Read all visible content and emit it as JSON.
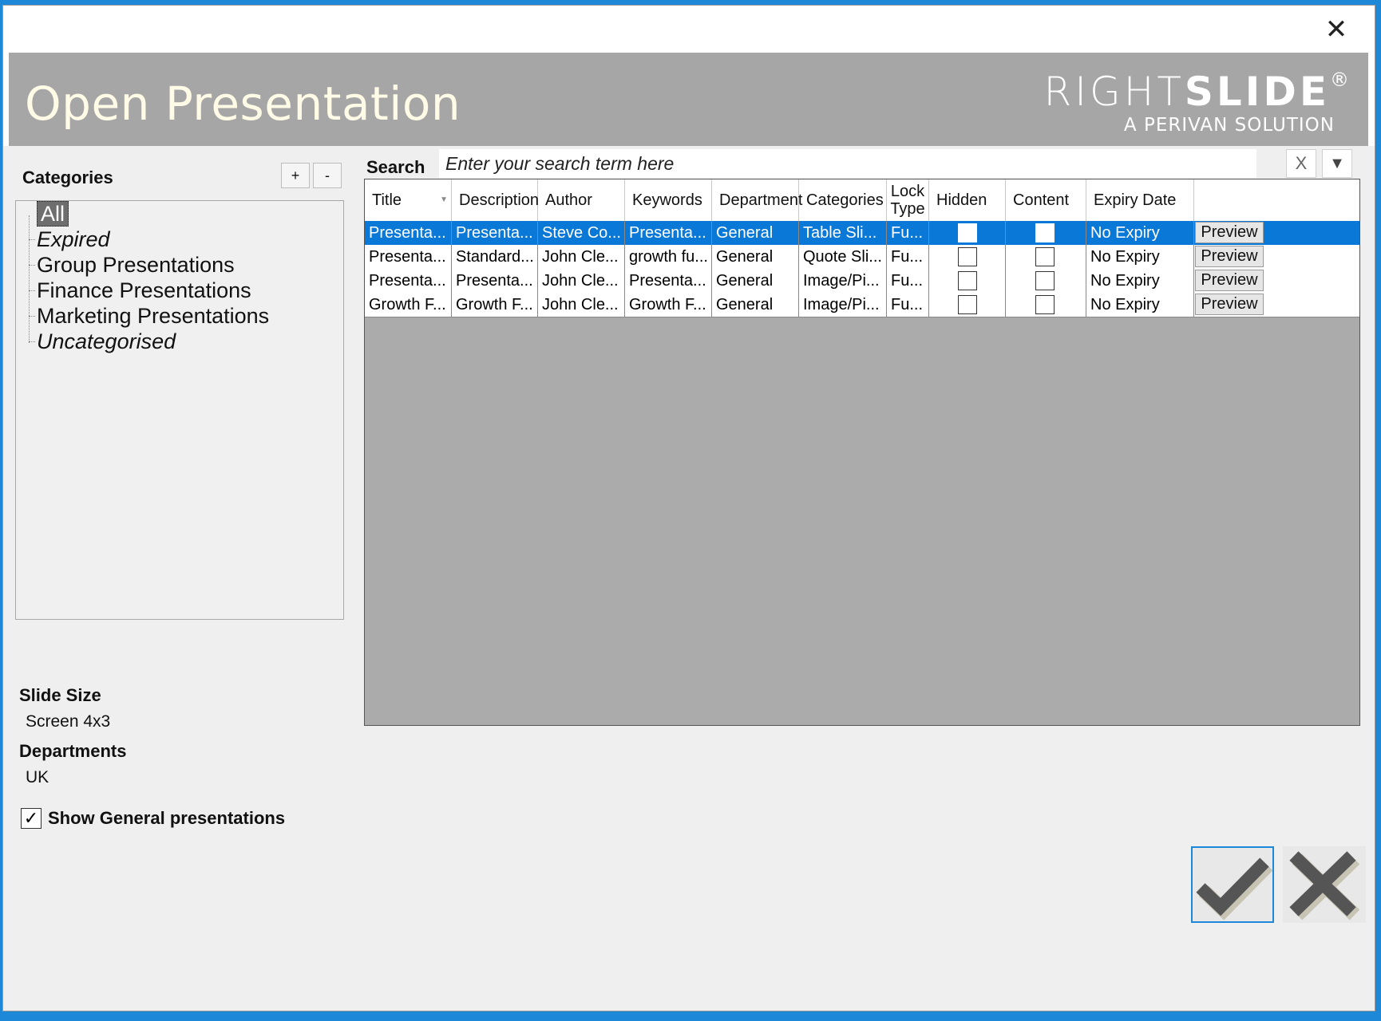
{
  "window": {
    "close_label": "✕"
  },
  "banner": {
    "title": "Open Presentation",
    "logo_right": "RIGHT",
    "logo_slide": "SLIDE",
    "logo_reg": "®",
    "logo_sub": "A PERIVAN SOLUTION"
  },
  "categories": {
    "label": "Categories",
    "add_label": "+",
    "remove_label": "-",
    "items": [
      {
        "label": "All",
        "selected": true,
        "italic": false
      },
      {
        "label": "Expired",
        "selected": false,
        "italic": true
      },
      {
        "label": "Group Presentations",
        "selected": false,
        "italic": false
      },
      {
        "label": "Finance Presentations",
        "selected": false,
        "italic": false
      },
      {
        "label": "Marketing Presentations",
        "selected": false,
        "italic": false
      },
      {
        "label": "Uncategorised",
        "selected": false,
        "italic": true
      }
    ]
  },
  "slide_size": {
    "label": "Slide Size",
    "value": "Screen 4x3"
  },
  "departments": {
    "label": "Departments",
    "value": "UK"
  },
  "show_general": {
    "label": "Show General presentations",
    "checked": true
  },
  "search": {
    "label": "Search",
    "placeholder": "Enter your search term here",
    "clear_label": "X",
    "dropdown_label": "▼"
  },
  "grid": {
    "columns": [
      "Title",
      "Description",
      "Author",
      "Keywords",
      "Department",
      "Categories",
      "Lock Type",
      "Hidden",
      "Content",
      "Expiry Date"
    ],
    "lock_type_line1": "Lock",
    "lock_type_line2": "Type",
    "preview_label": "Preview",
    "rows": [
      {
        "title": "Presenta...",
        "description": "Presenta...",
        "author": "Steve Co...",
        "keywords": "Presenta...",
        "department": "General",
        "categories": "Table Sli...",
        "lock_type": "Fu...",
        "hidden": false,
        "content": false,
        "expiry": "No Expiry",
        "selected": true
      },
      {
        "title": "Presenta...",
        "description": "Standard...",
        "author": "John Cle...",
        "keywords": "growth fu...",
        "department": "General",
        "categories": "Quote Sli...",
        "lock_type": "Fu...",
        "hidden": false,
        "content": false,
        "expiry": "No Expiry",
        "selected": false
      },
      {
        "title": "Presenta...",
        "description": "Presenta...",
        "author": "John Cle...",
        "keywords": "Presenta...",
        "department": "General",
        "categories": "Image/Pi...",
        "lock_type": "Fu...",
        "hidden": false,
        "content": false,
        "expiry": "No Expiry",
        "selected": false
      },
      {
        "title": "Growth F...",
        "description": "Growth F...",
        "author": "John Cle...",
        "keywords": "Growth F...",
        "department": "General",
        "categories": "Image/Pi...",
        "lock_type": "Fu...",
        "hidden": false,
        "content": false,
        "expiry": "No Expiry",
        "selected": false
      }
    ]
  },
  "view_mode": {
    "selected": "grid",
    "options": [
      "grid-view-icon",
      "thumbnail-view-icon"
    ]
  },
  "colors": {
    "selection_blue": "#0a78d7",
    "banner_gray": "#a6a6a6",
    "title_cream": "#fffbe6",
    "accent_border": "#1e88d8"
  }
}
